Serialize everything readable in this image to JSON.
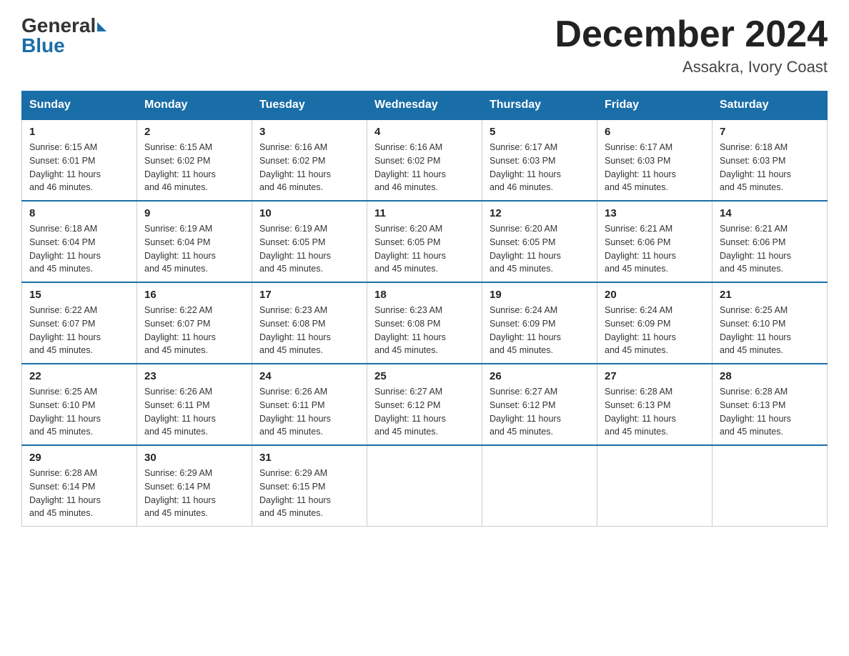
{
  "header": {
    "logo_general": "General",
    "logo_blue": "Blue",
    "month_year": "December 2024",
    "location": "Assakra, Ivory Coast"
  },
  "days_of_week": [
    "Sunday",
    "Monday",
    "Tuesday",
    "Wednesday",
    "Thursday",
    "Friday",
    "Saturday"
  ],
  "weeks": [
    [
      {
        "num": "1",
        "sunrise": "6:15 AM",
        "sunset": "6:01 PM",
        "daylight": "11 hours and 46 minutes."
      },
      {
        "num": "2",
        "sunrise": "6:15 AM",
        "sunset": "6:02 PM",
        "daylight": "11 hours and 46 minutes."
      },
      {
        "num": "3",
        "sunrise": "6:16 AM",
        "sunset": "6:02 PM",
        "daylight": "11 hours and 46 minutes."
      },
      {
        "num": "4",
        "sunrise": "6:16 AM",
        "sunset": "6:02 PM",
        "daylight": "11 hours and 46 minutes."
      },
      {
        "num": "5",
        "sunrise": "6:17 AM",
        "sunset": "6:03 PM",
        "daylight": "11 hours and 46 minutes."
      },
      {
        "num": "6",
        "sunrise": "6:17 AM",
        "sunset": "6:03 PM",
        "daylight": "11 hours and 45 minutes."
      },
      {
        "num": "7",
        "sunrise": "6:18 AM",
        "sunset": "6:03 PM",
        "daylight": "11 hours and 45 minutes."
      }
    ],
    [
      {
        "num": "8",
        "sunrise": "6:18 AM",
        "sunset": "6:04 PM",
        "daylight": "11 hours and 45 minutes."
      },
      {
        "num": "9",
        "sunrise": "6:19 AM",
        "sunset": "6:04 PM",
        "daylight": "11 hours and 45 minutes."
      },
      {
        "num": "10",
        "sunrise": "6:19 AM",
        "sunset": "6:05 PM",
        "daylight": "11 hours and 45 minutes."
      },
      {
        "num": "11",
        "sunrise": "6:20 AM",
        "sunset": "6:05 PM",
        "daylight": "11 hours and 45 minutes."
      },
      {
        "num": "12",
        "sunrise": "6:20 AM",
        "sunset": "6:05 PM",
        "daylight": "11 hours and 45 minutes."
      },
      {
        "num": "13",
        "sunrise": "6:21 AM",
        "sunset": "6:06 PM",
        "daylight": "11 hours and 45 minutes."
      },
      {
        "num": "14",
        "sunrise": "6:21 AM",
        "sunset": "6:06 PM",
        "daylight": "11 hours and 45 minutes."
      }
    ],
    [
      {
        "num": "15",
        "sunrise": "6:22 AM",
        "sunset": "6:07 PM",
        "daylight": "11 hours and 45 minutes."
      },
      {
        "num": "16",
        "sunrise": "6:22 AM",
        "sunset": "6:07 PM",
        "daylight": "11 hours and 45 minutes."
      },
      {
        "num": "17",
        "sunrise": "6:23 AM",
        "sunset": "6:08 PM",
        "daylight": "11 hours and 45 minutes."
      },
      {
        "num": "18",
        "sunrise": "6:23 AM",
        "sunset": "6:08 PM",
        "daylight": "11 hours and 45 minutes."
      },
      {
        "num": "19",
        "sunrise": "6:24 AM",
        "sunset": "6:09 PM",
        "daylight": "11 hours and 45 minutes."
      },
      {
        "num": "20",
        "sunrise": "6:24 AM",
        "sunset": "6:09 PM",
        "daylight": "11 hours and 45 minutes."
      },
      {
        "num": "21",
        "sunrise": "6:25 AM",
        "sunset": "6:10 PM",
        "daylight": "11 hours and 45 minutes."
      }
    ],
    [
      {
        "num": "22",
        "sunrise": "6:25 AM",
        "sunset": "6:10 PM",
        "daylight": "11 hours and 45 minutes."
      },
      {
        "num": "23",
        "sunrise": "6:26 AM",
        "sunset": "6:11 PM",
        "daylight": "11 hours and 45 minutes."
      },
      {
        "num": "24",
        "sunrise": "6:26 AM",
        "sunset": "6:11 PM",
        "daylight": "11 hours and 45 minutes."
      },
      {
        "num": "25",
        "sunrise": "6:27 AM",
        "sunset": "6:12 PM",
        "daylight": "11 hours and 45 minutes."
      },
      {
        "num": "26",
        "sunrise": "6:27 AM",
        "sunset": "6:12 PM",
        "daylight": "11 hours and 45 minutes."
      },
      {
        "num": "27",
        "sunrise": "6:28 AM",
        "sunset": "6:13 PM",
        "daylight": "11 hours and 45 minutes."
      },
      {
        "num": "28",
        "sunrise": "6:28 AM",
        "sunset": "6:13 PM",
        "daylight": "11 hours and 45 minutes."
      }
    ],
    [
      {
        "num": "29",
        "sunrise": "6:28 AM",
        "sunset": "6:14 PM",
        "daylight": "11 hours and 45 minutes."
      },
      {
        "num": "30",
        "sunrise": "6:29 AM",
        "sunset": "6:14 PM",
        "daylight": "11 hours and 45 minutes."
      },
      {
        "num": "31",
        "sunrise": "6:29 AM",
        "sunset": "6:15 PM",
        "daylight": "11 hours and 45 minutes."
      },
      null,
      null,
      null,
      null
    ]
  ],
  "labels": {
    "sunrise": "Sunrise:",
    "sunset": "Sunset:",
    "daylight": "Daylight:"
  }
}
